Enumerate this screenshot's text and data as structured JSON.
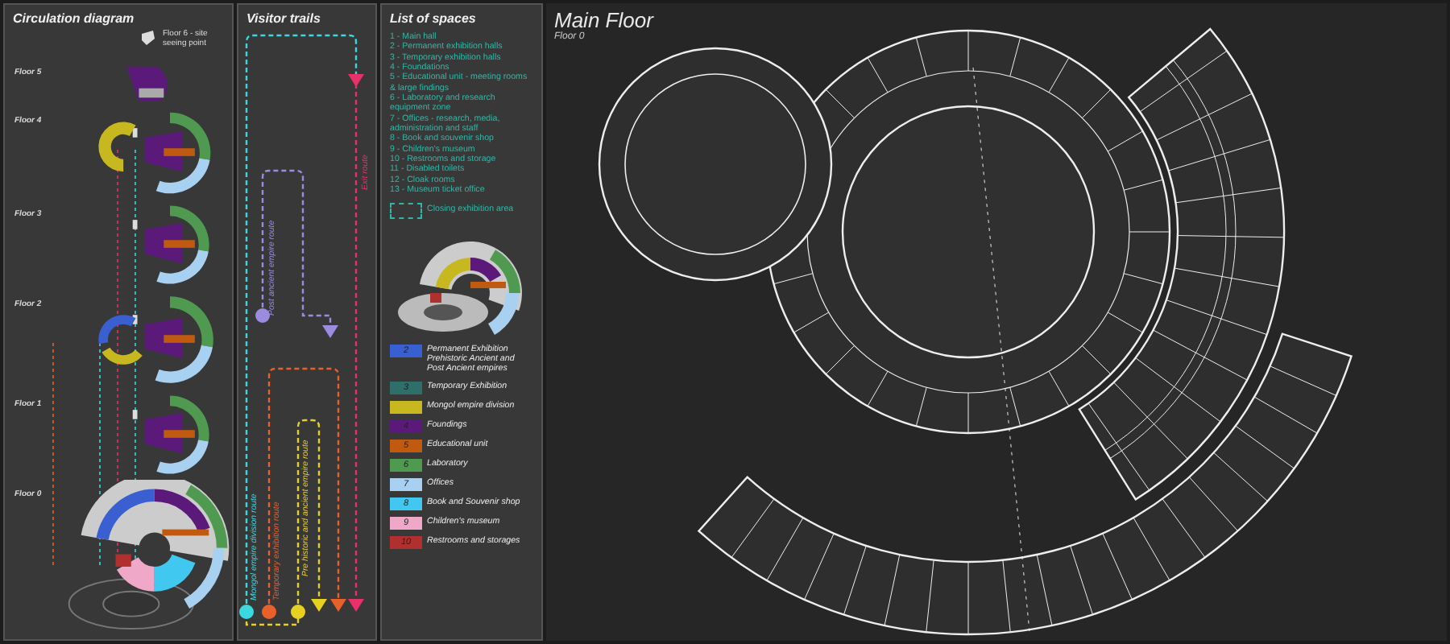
{
  "circulation": {
    "title": "Circulation diagram",
    "note": "Floor 6 - site seeing point",
    "floors": [
      {
        "label": "Floor 5",
        "kind": "top"
      },
      {
        "label": "Floor 4",
        "kind": "mongol"
      },
      {
        "label": "Floor 3",
        "kind": "wing"
      },
      {
        "label": "Floor 2",
        "kind": "permanent"
      },
      {
        "label": "Floor 1",
        "kind": "wing"
      },
      {
        "label": "Floor 0",
        "kind": "ground"
      }
    ]
  },
  "visitor_trails": {
    "title": "Visitor trails",
    "routes": [
      {
        "label": "Exit route",
        "color": "#e8306a"
      },
      {
        "label": "Post ancient empire route",
        "color": "#9c8ce0"
      },
      {
        "label": "Mongol empire division route",
        "color": "#3ad8e0"
      },
      {
        "label": "Temporary exhibition route",
        "color": "#e8602a"
      },
      {
        "label": "Pre historic and ancient empire route",
        "color": "#e8d020"
      }
    ]
  },
  "list_of_spaces": {
    "title": "List of spaces",
    "items": [
      "1 - Main hall",
      "2 - Permanent exhibition halls",
      "3 - Temporary exhibition halls",
      "4 - Foundations",
      "5 - Educational unit - meeting rooms & large findings",
      "6 - Laboratory and research equipment zone",
      "7 - Offices - research, media, administration and staff",
      "8 - Book and souvenir shop",
      "9 - Children's museum",
      "10 - Restrooms and storage",
      "11 - Disabled toilets",
      "12 - Cloak rooms",
      "13 - Museum ticket office"
    ],
    "dashed_note": "Closing exhibition area",
    "legend": [
      {
        "number": "2",
        "label": "Permanent Exhibition Prehistoric Ancient and Post Ancient empires",
        "color": "#3a5fd0"
      },
      {
        "number": "3",
        "label": "Temporary Exhibition",
        "color": "#2f6f6a"
      },
      {
        "label": "Mongol empire division",
        "color": "#c8b820"
      },
      {
        "number": "4",
        "label": "Foundings",
        "color": "#5b1a7a"
      },
      {
        "number": "5",
        "label": "Educational unit",
        "color": "#c05a10"
      },
      {
        "number": "6",
        "label": "Laboratory",
        "color": "#4f9a50"
      },
      {
        "number": "7",
        "label": "Offices",
        "color": "#a8d0f0"
      },
      {
        "number": "8",
        "label": "Book and Souvenir shop",
        "color": "#40c8f0"
      },
      {
        "number": "9",
        "label": "Children's museum",
        "color": "#f0a8c8"
      },
      {
        "number": "10",
        "label": "Restrooms and storages",
        "color": "#b03030"
      }
    ]
  },
  "main_floor": {
    "title": "Main Floor",
    "subtitle": "Floor 0"
  }
}
